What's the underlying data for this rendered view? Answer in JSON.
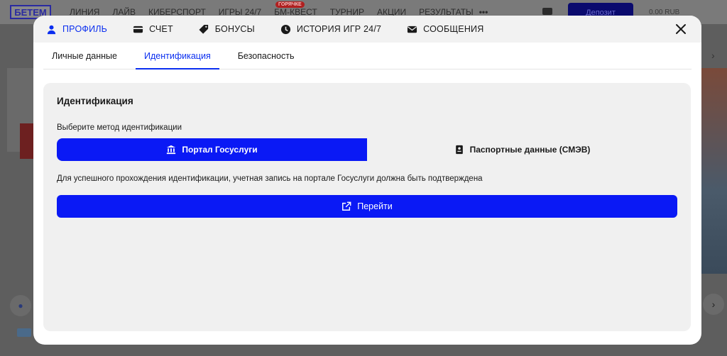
{
  "background": {
    "logo": "БЕТЕМ",
    "nav": [
      "ЛИНИЯ",
      "ЛАЙВ",
      "КИБЕРСПОРТ",
      "ИГРЫ 24/7",
      "БМ-КВЕСТ",
      "ТУРНИР",
      "АКЦИИ",
      "РЕЗУЛЬТАТЫ"
    ],
    "hot_badge": "ГОРЯЧКЕ",
    "more": "•••",
    "deposit_label": "Депозит",
    "balance": "0.00 RUB"
  },
  "modal": {
    "tabs": [
      {
        "label": "ПРОФИЛЬ",
        "icon": "user-icon",
        "active": true
      },
      {
        "label": "СЧЕТ",
        "icon": "card-icon",
        "active": false
      },
      {
        "label": "БОНУСЫ",
        "icon": "tag-icon",
        "active": false
      },
      {
        "label": "ИСТОРИЯ ИГР 24/7",
        "icon": "clock-icon",
        "active": false
      },
      {
        "label": "СООБЩЕНИЯ",
        "icon": "mail-icon",
        "active": false
      }
    ],
    "subtabs": [
      {
        "label": "Личные данные",
        "active": false
      },
      {
        "label": "Идентификация",
        "active": true
      },
      {
        "label": "Безопасность",
        "active": false
      }
    ],
    "panel": {
      "title": "Идентификация",
      "method_label": "Выберите метод идентификации",
      "methods": [
        {
          "label": "Портал Госуслуги",
          "icon": "bank-icon",
          "active": true
        },
        {
          "label": "Паспортные данные (СМЭВ)",
          "icon": "id-card-icon",
          "active": false
        }
      ],
      "info_text": "Для успешного прохождения идентификации, учетная запись на портале Госуслуги должна быть подтверждена",
      "go_label": "Перейти"
    }
  },
  "colors": {
    "accent": "#0a19f5",
    "tab_active": "#0a2ef0",
    "panel_bg": "#f0f0f0",
    "overlay": "#5e5e5e"
  }
}
